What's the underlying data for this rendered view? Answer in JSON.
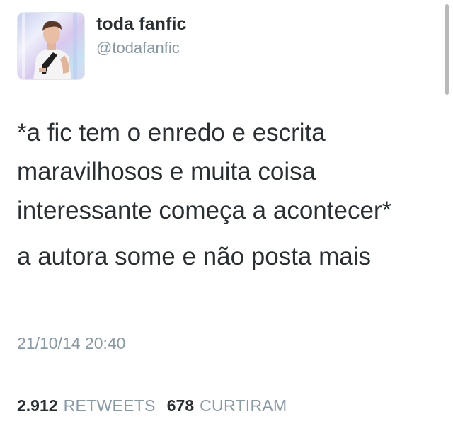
{
  "user": {
    "display_name": "toda fanfic",
    "handle": "@todafanfic"
  },
  "tweet": {
    "text_1": "*a fic tem o enredo e escrita maravilhosos e muita coisa interessante começa a acontecer*",
    "text_2": "a autora some e não posta mais",
    "timestamp": "21/10/14 20:40"
  },
  "stats": {
    "retweets_count": "2.912",
    "retweets_label": "RETWEETS",
    "likes_count": "678",
    "likes_label": "CURTIRAM"
  },
  "colors": {
    "text": "#292f33",
    "muted": "#8899a6",
    "divider": "#e1e8ed"
  },
  "icons": {
    "avatar": "profile-photo"
  }
}
